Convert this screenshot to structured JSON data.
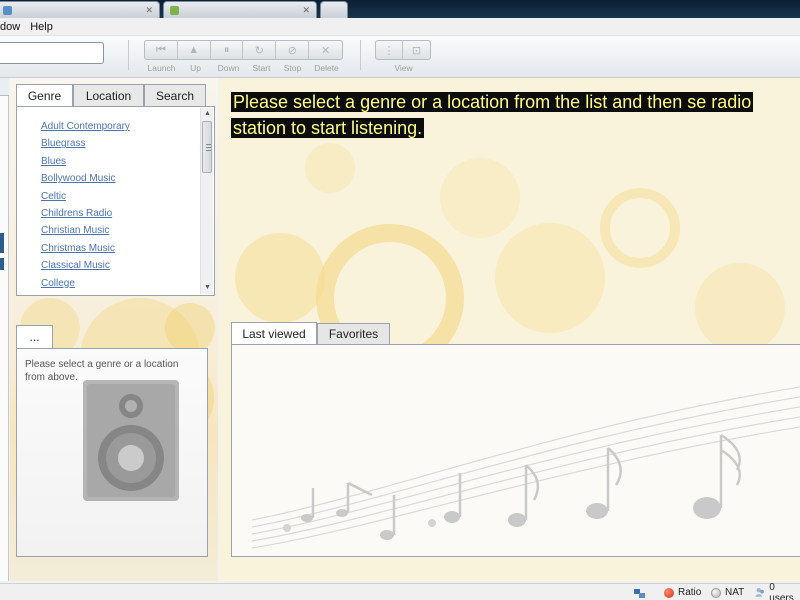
{
  "menubar": {
    "items": [
      "dow",
      "Help"
    ]
  },
  "toolbar": {
    "group1": [
      {
        "label": "Launch",
        "icon": "launch-icon"
      },
      {
        "label": "Up",
        "icon": "up-icon"
      },
      {
        "label": "Down",
        "icon": "down-icon"
      },
      {
        "label": "Start",
        "icon": "start-icon"
      },
      {
        "label": "Stop",
        "icon": "stop-icon"
      },
      {
        "label": "Delete",
        "icon": "delete-icon"
      }
    ],
    "view_label": "View"
  },
  "genre_panel": {
    "tabs": [
      "Genre",
      "Location",
      "Search"
    ],
    "genres": [
      "Adult Contemporary",
      "Bluegrass",
      "Blues",
      "Bollywood Music",
      "Celtic",
      "Childrens Radio",
      "Christian Music",
      "Christmas Music",
      "Classical Music",
      "College"
    ]
  },
  "details_panel": {
    "tab_label": "...",
    "message": "Please select a genre or a location from above."
  },
  "main": {
    "notice": "Please select a genre or a location from the list and then se radio station to start listening.",
    "tabs": [
      "Last viewed",
      "Favorites"
    ]
  },
  "statusbar": {
    "ratio_label": "Ratio",
    "nat_label": "NAT",
    "users_label": "0 users"
  },
  "colors": {
    "link": "#4b73b4",
    "notice_bg": "#0c0c0c",
    "notice_text": "#ffff88",
    "ratio_dot": "#d0321a"
  }
}
